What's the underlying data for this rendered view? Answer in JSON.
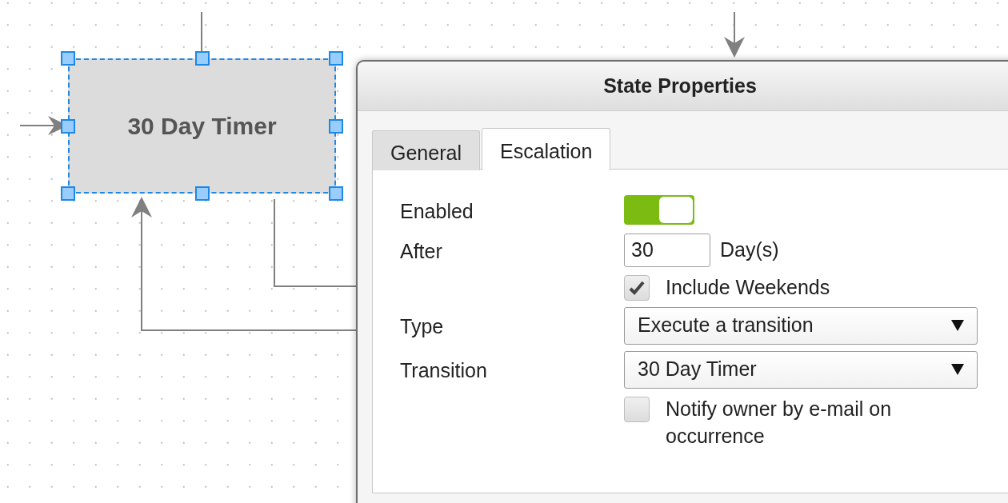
{
  "diagram": {
    "node": {
      "label": "30 Day Timer",
      "selected": true
    }
  },
  "dialog": {
    "title": "State Properties",
    "tabs": [
      {
        "label": "General",
        "selected": false
      },
      {
        "label": "Escalation",
        "selected": true
      }
    ],
    "fields": [
      {
        "kind": "toggle",
        "label": "Enabled",
        "on": true
      },
      {
        "kind": "number",
        "label": "After",
        "value": "30",
        "unit": "Day(s)"
      },
      {
        "kind": "checkbox",
        "label": "Include Weekends",
        "checked": true
      },
      {
        "kind": "select",
        "label": "Type",
        "value": "Execute a transition"
      },
      {
        "kind": "select",
        "label": "Transition",
        "value": "30 Day Timer"
      },
      {
        "kind": "checkbox",
        "label": "Notify owner by e-mail on occurrence",
        "checked": false
      }
    ]
  }
}
